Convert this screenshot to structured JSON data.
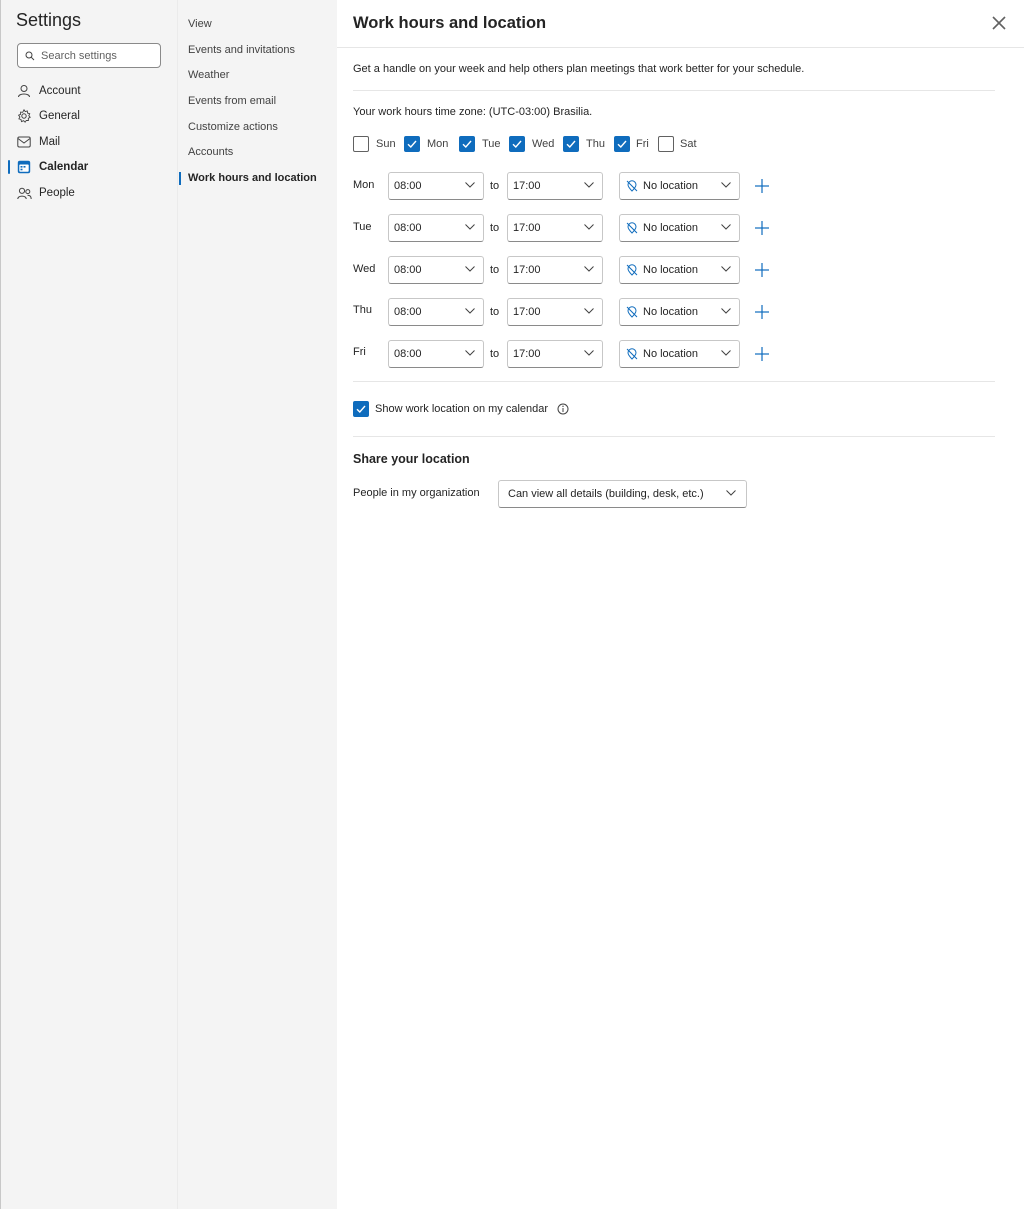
{
  "app": {
    "title": "Settings"
  },
  "search": {
    "placeholder": "Search settings"
  },
  "sidebar": {
    "items": [
      {
        "label": "Account",
        "icon": "person-icon"
      },
      {
        "label": "General",
        "icon": "gear-icon"
      },
      {
        "label": "Mail",
        "icon": "mail-icon"
      },
      {
        "label": "Calendar",
        "icon": "calendar-icon",
        "selected": true
      },
      {
        "label": "People",
        "icon": "people-icon"
      }
    ]
  },
  "subnav": {
    "items": [
      {
        "label": "View"
      },
      {
        "label": "Events and invitations"
      },
      {
        "label": "Weather"
      },
      {
        "label": "Events from email"
      },
      {
        "label": "Customize actions"
      },
      {
        "label": "Accounts"
      },
      {
        "label": "Work hours and location",
        "selected": true
      }
    ]
  },
  "main": {
    "title": "Work hours and location",
    "description": "Get a handle on your week and help others plan meetings that work better for your schedule.",
    "timezone": "Your work hours time zone: (UTC-03:00) Brasilia.",
    "days": [
      {
        "label": "Sun",
        "checked": false
      },
      {
        "label": "Mon",
        "checked": true
      },
      {
        "label": "Tue",
        "checked": true
      },
      {
        "label": "Wed",
        "checked": true
      },
      {
        "label": "Thu",
        "checked": true
      },
      {
        "label": "Fri",
        "checked": true
      },
      {
        "label": "Sat",
        "checked": false
      }
    ],
    "to_label": "to",
    "schedule": [
      {
        "day": "Mon",
        "start": "08:00",
        "end": "17:00",
        "location": "No location"
      },
      {
        "day": "Tue",
        "start": "08:00",
        "end": "17:00",
        "location": "No location"
      },
      {
        "day": "Wed",
        "start": "08:00",
        "end": "17:00",
        "location": "No location"
      },
      {
        "day": "Thu",
        "start": "08:00",
        "end": "17:00",
        "location": "No location"
      },
      {
        "day": "Fri",
        "start": "08:00",
        "end": "17:00",
        "location": "No location"
      }
    ],
    "show_location": {
      "label": "Show work location on my calendar",
      "checked": true
    },
    "share": {
      "title": "Share your location",
      "label": "People in my organization",
      "value": "Can view all details (building, desk, etc.)"
    }
  },
  "colors": {
    "accent": "#0f6cbd",
    "pane_bg": "#f4f4f4"
  }
}
